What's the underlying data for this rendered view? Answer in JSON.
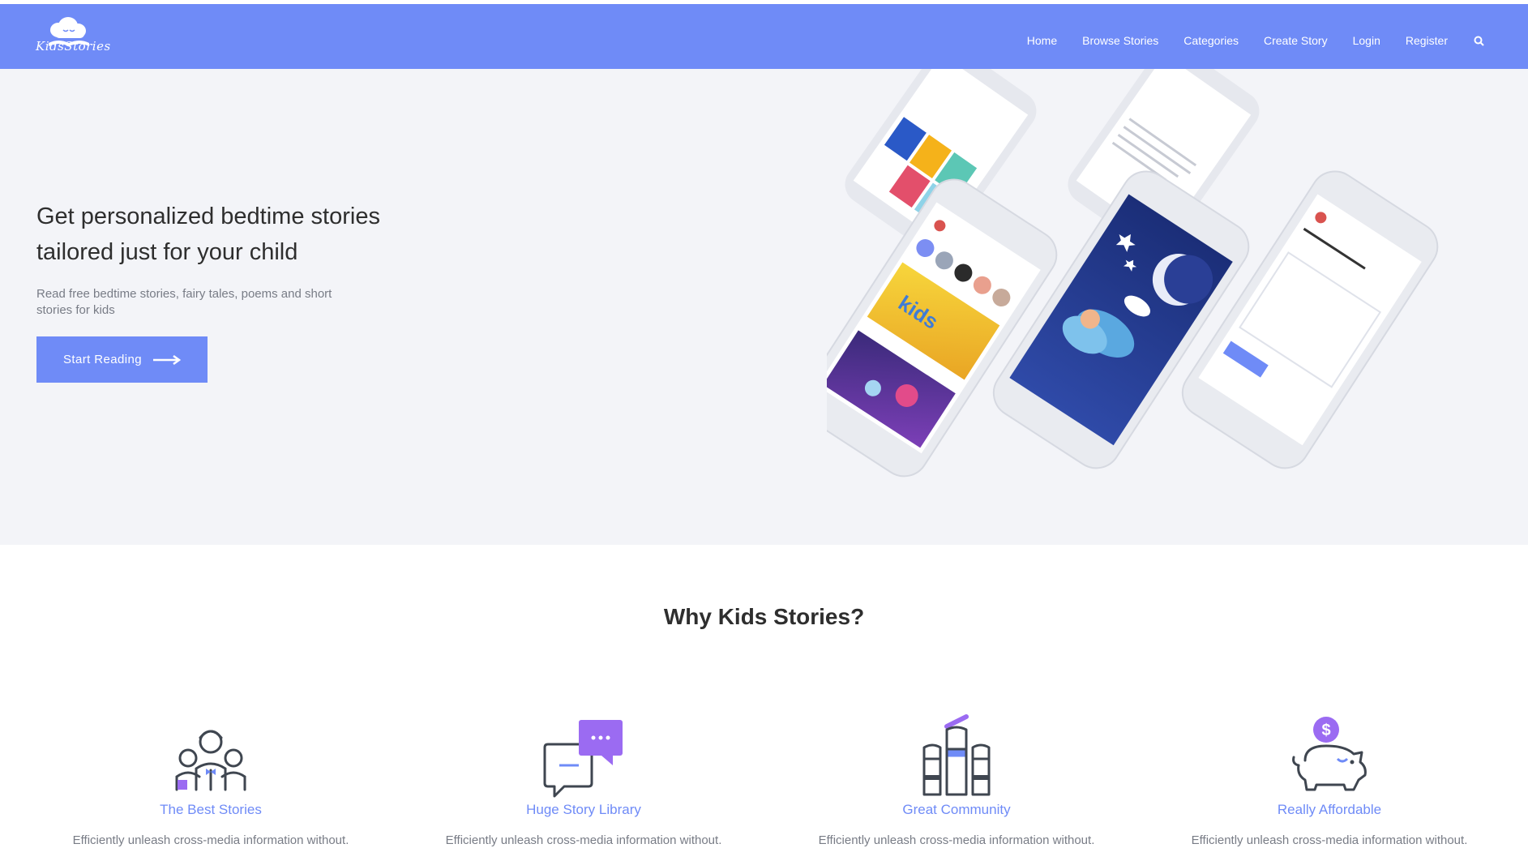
{
  "brand": {
    "logo_text": "KidsStories"
  },
  "nav": {
    "items": [
      "Home",
      "Browse Stories",
      "Categories",
      "Create Story",
      "Login",
      "Register"
    ],
    "search_icon": "search-icon"
  },
  "hero": {
    "title": "Get personalized bedtime stories tailored just for your child",
    "subtitle": "Read free bedtime stories, fairy tales, poems and short stories for kids",
    "cta_label": "Start Reading"
  },
  "why": {
    "heading": "Why Kids Stories?"
  },
  "features": [
    {
      "icon": "family-icon",
      "title": "The Best Stories",
      "desc": "Efficiently unleash cross-media information without."
    },
    {
      "icon": "chat-bubbles-icon",
      "title": "Huge Story Library",
      "desc": "Efficiently unleash cross-media information without."
    },
    {
      "icon": "raised-hands-icon",
      "title": "Great Community",
      "desc": "Efficiently unleash cross-media information without."
    },
    {
      "icon": "piggy-bank-icon",
      "title": "Really Affordable",
      "desc": "Efficiently unleash cross-media information without."
    }
  ],
  "colors": {
    "primary": "#6f8bf7",
    "hero_bg": "#f3f4f8",
    "accent_purple": "#9b6bf2",
    "icon_stroke": "#3f4650"
  }
}
